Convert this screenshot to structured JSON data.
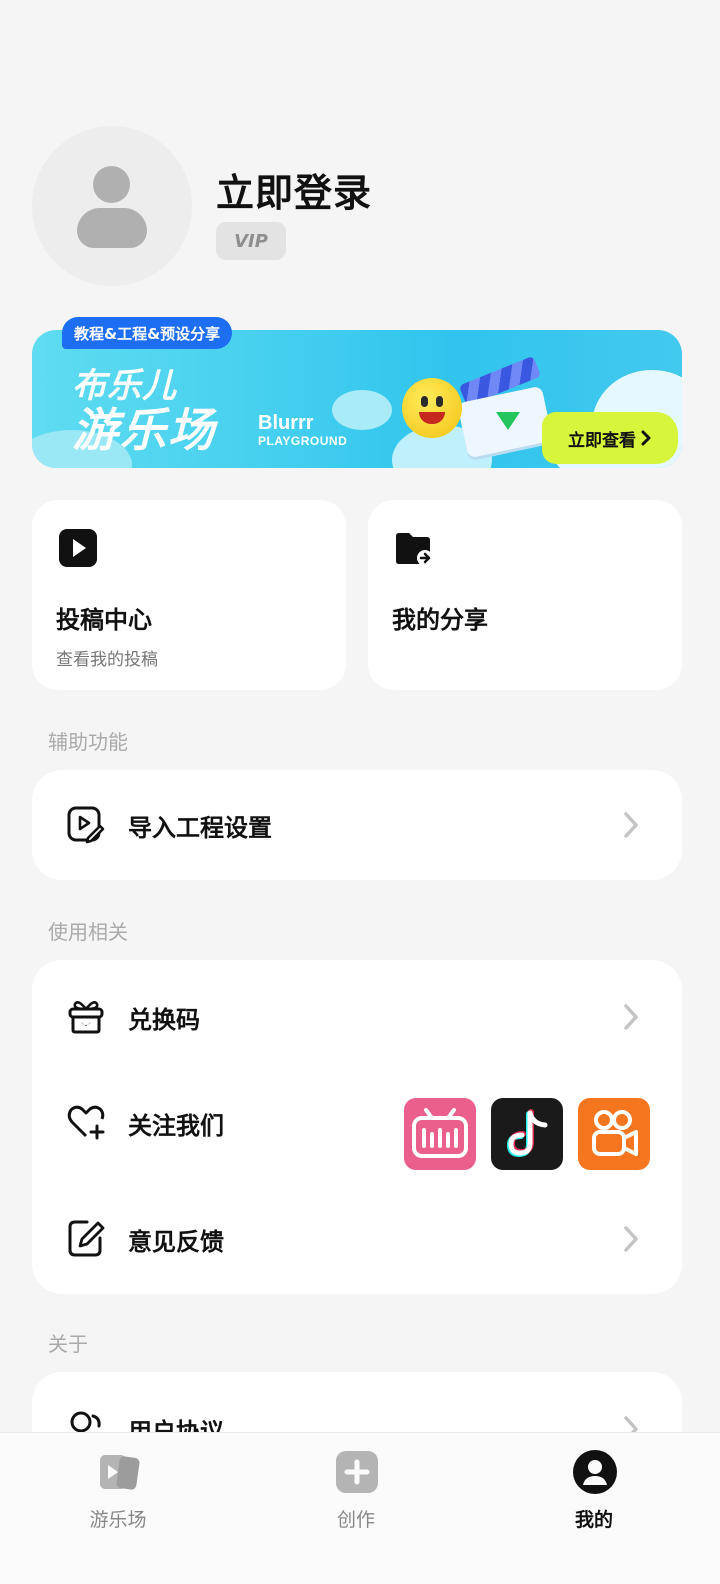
{
  "profile": {
    "login_title": "立即登录",
    "vip_badge": "VIP"
  },
  "banner": {
    "tag": "教程&工程&预设分享",
    "title_line1": "布乐儿",
    "title_line2": "游乐场",
    "brand_line1": "Blurrr",
    "brand_line2": "PLAYGROUND",
    "cta": "立即查看",
    "cta_icon": "chevron-right-icon"
  },
  "cards": [
    {
      "title": "投稿中心",
      "subtitle": "查看我的投稿",
      "icon": "play-square-icon"
    },
    {
      "title": "我的分享",
      "subtitle": "",
      "icon": "folder-share-icon"
    }
  ],
  "sections": {
    "assist": {
      "label": "辅助功能",
      "items": [
        {
          "label": "导入工程设置",
          "icon": "import-project-icon"
        }
      ]
    },
    "usage": {
      "label": "使用相关",
      "items": [
        {
          "label": "兑换码",
          "icon": "gift-icon"
        },
        {
          "label": "关注我们",
          "icon": "heart-plus-icon",
          "socials": [
            "bilibili",
            "douyin",
            "kuaishou"
          ]
        },
        {
          "label": "意见反馈",
          "icon": "feedback-edit-icon"
        }
      ]
    },
    "about": {
      "label": "关于",
      "items": [
        {
          "label": "用户协议",
          "icon": "user-agreement-icon"
        }
      ]
    }
  },
  "tabbar": {
    "tabs": [
      {
        "label": "游乐场",
        "icon": "playground-icon",
        "active": false
      },
      {
        "label": "创作",
        "icon": "create-plus-icon",
        "active": false
      },
      {
        "label": "我的",
        "icon": "profile-icon",
        "active": true
      }
    ]
  },
  "colors": {
    "background": "#f5f5f5",
    "card": "#ffffff",
    "cta_accent": "#d7f53a",
    "tag_blue": "#1d6ef2",
    "bilibili": "#eb5f8c",
    "douyin": "#1a1a1a",
    "kuaishou": "#f5761f"
  }
}
